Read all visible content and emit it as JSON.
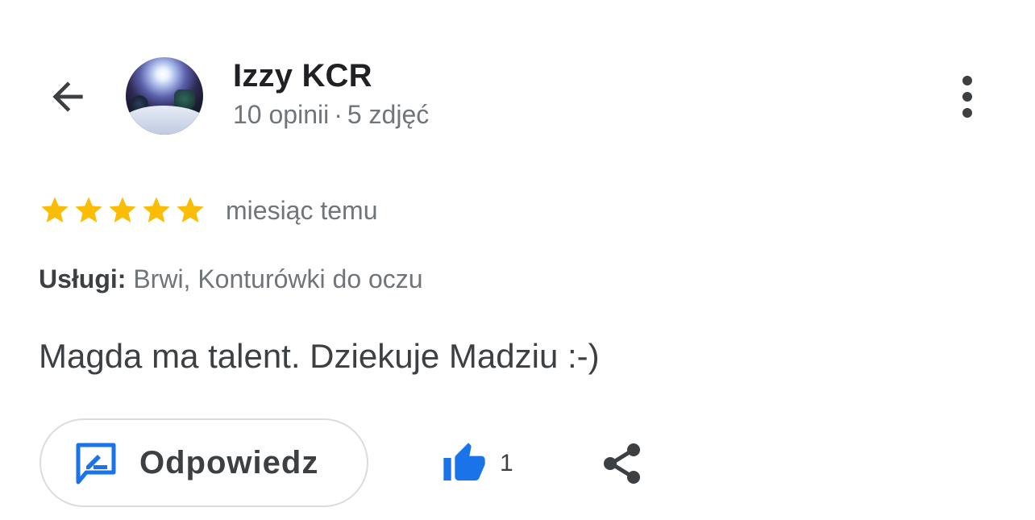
{
  "header": {
    "back_icon": "arrow-back-icon",
    "more_icon": "more-vertical-icon"
  },
  "reviewer": {
    "name": "Izzy KCR",
    "reviews": "10 opinii",
    "separator": "·",
    "photos": "5 zdjęć"
  },
  "rating": {
    "stars": 5,
    "max_stars": 5,
    "star_color": "#fbbc04",
    "date": "miesiąc temu"
  },
  "services": {
    "label": "Usługi:",
    "value": "Brwi, Konturówki do oczu"
  },
  "review": {
    "text": "Magda ma talent. Dziekuje Madziu :-)"
  },
  "actions": {
    "reply_label": "Odpowiedz",
    "reply_icon": "reply-edit-icon",
    "like_icon": "thumb-up-icon",
    "like_count": "1",
    "share_icon": "share-icon",
    "accent_color": "#1a73e8"
  }
}
